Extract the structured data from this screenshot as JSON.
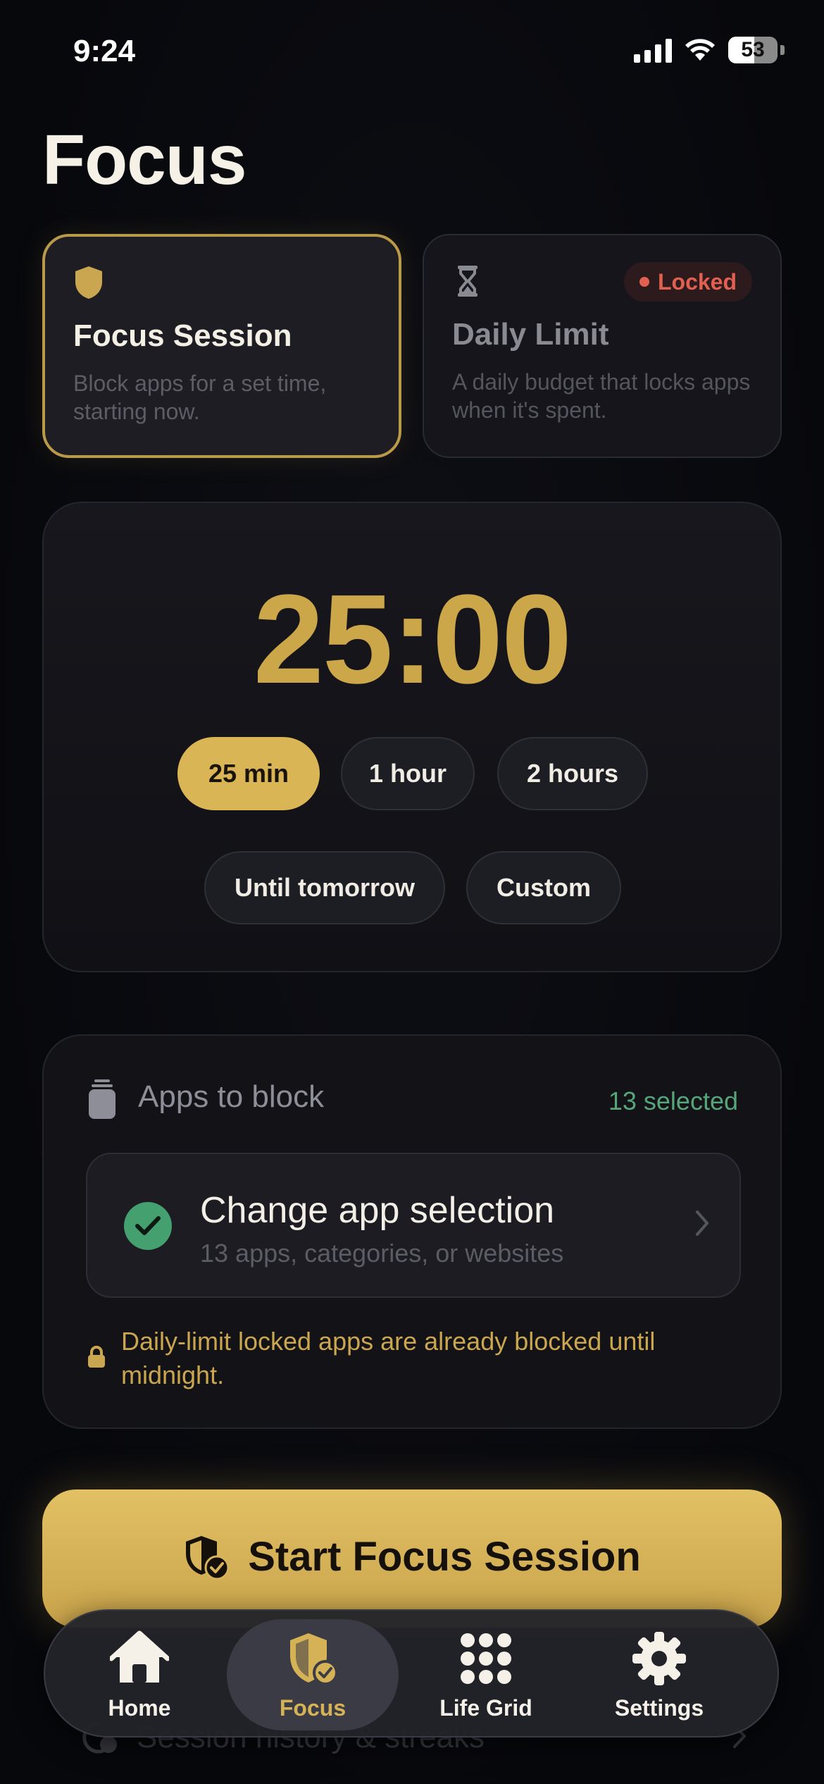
{
  "status_bar": {
    "time": "9:24",
    "battery": "53",
    "battery_level": 0.53
  },
  "page": {
    "title": "Focus"
  },
  "modes": [
    {
      "title": "Focus Session",
      "description": "Block apps for a set time, starting now.",
      "selected": true,
      "icon": "shield-icon"
    },
    {
      "title": "Daily Limit",
      "description": "A daily budget that locks apps when it's spent.",
      "selected": false,
      "badge": "Locked",
      "icon": "hourglass-icon"
    }
  ],
  "timer": {
    "value": "25:00",
    "durations": [
      "25 min",
      "1 hour",
      "2 hours",
      "Until tomorrow",
      "Custom"
    ],
    "selected_duration": "25 min"
  },
  "apps": {
    "header": "Apps to block",
    "count": "13 selected",
    "change_title": "Change app selection",
    "change_subtitle": "13 apps, categories, or websites",
    "note": "Daily-limit locked apps are already blocked until midnight."
  },
  "start_button": {
    "label": "Start Focus Session"
  },
  "history": {
    "label": "Session history & streaks"
  },
  "tabs": [
    {
      "label": "Home",
      "icon": "home-icon"
    },
    {
      "label": "Focus",
      "icon": "shield-check-icon",
      "active": true
    },
    {
      "label": "Life Grid",
      "icon": "grid-icon"
    },
    {
      "label": "Settings",
      "icon": "gear-icon"
    }
  ],
  "colors": {
    "accent_gold": "#cba74a",
    "button_gold": "#d9b555",
    "locked_red": "#e0614f",
    "success_green": "#44a06f",
    "background": "#08090e"
  }
}
